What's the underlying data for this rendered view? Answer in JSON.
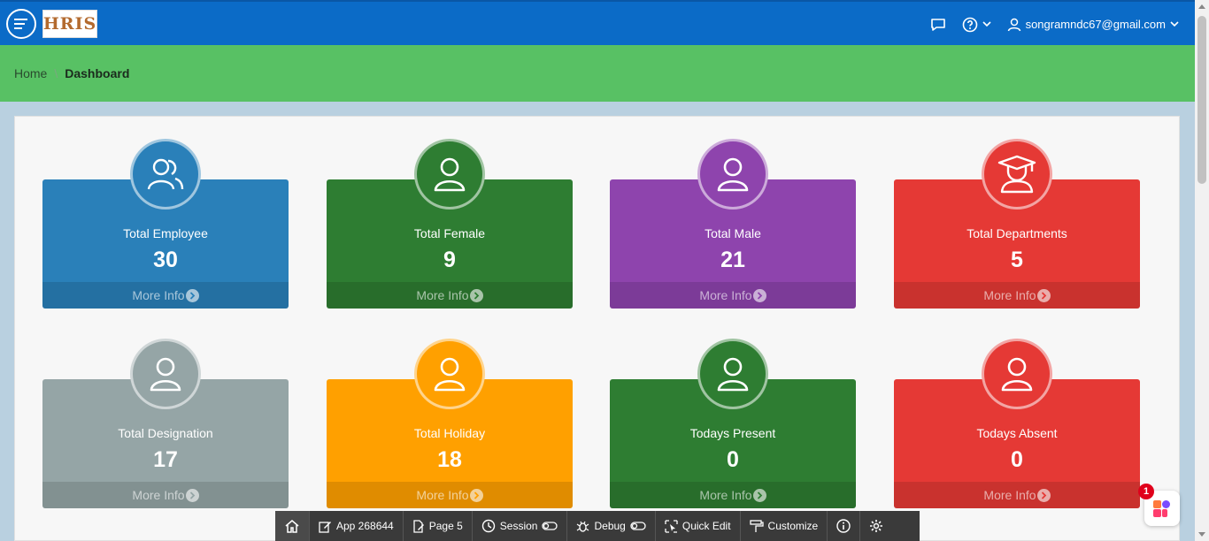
{
  "header": {
    "logo_text": "HRIS",
    "user_email": "songramndc67@gmail.com"
  },
  "breadcrumb": {
    "home": "Home",
    "separator": "\\",
    "current": "Dashboard"
  },
  "cards": [
    {
      "label": "Total Employee",
      "value": "30",
      "more": "More Info",
      "icon": "users-icon",
      "color": "#2a80b9",
      "circle": "#2a80b9"
    },
    {
      "label": "Total Female",
      "value": "9",
      "more": "More Info",
      "icon": "user-icon",
      "color": "#2e7d32",
      "circle": "#2e7d32"
    },
    {
      "label": "Total Male",
      "value": "21",
      "more": "More Info",
      "icon": "user-icon",
      "color": "#8e44ad",
      "circle": "#8e44ad"
    },
    {
      "label": "Total Departments",
      "value": "5",
      "more": "More Info",
      "icon": "graduate-icon",
      "color": "#e53935",
      "circle": "#e53935"
    },
    {
      "label": "Total Designation",
      "value": "17",
      "more": "More Info",
      "icon": "user-icon",
      "color": "#95a5a6",
      "circle": "#95a5a6"
    },
    {
      "label": "Total Holiday",
      "value": "18",
      "more": "More Info",
      "icon": "user-icon",
      "color": "#ffa000",
      "circle": "#ffa000"
    },
    {
      "label": "Todays Present",
      "value": "0",
      "more": "More Info",
      "icon": "user-icon",
      "color": "#2e7d32",
      "circle": "#2e7d32"
    },
    {
      "label": "Todays Absent",
      "value": "0",
      "more": "More Info",
      "icon": "user-icon",
      "color": "#e53935",
      "circle": "#e53935"
    }
  ],
  "devbar": {
    "app": "App 268644",
    "page": "Page 5",
    "session": "Session",
    "debug": "Debug",
    "quick_edit": "Quick Edit",
    "customize": "Customize"
  },
  "widget": {
    "badge_count": "1"
  }
}
